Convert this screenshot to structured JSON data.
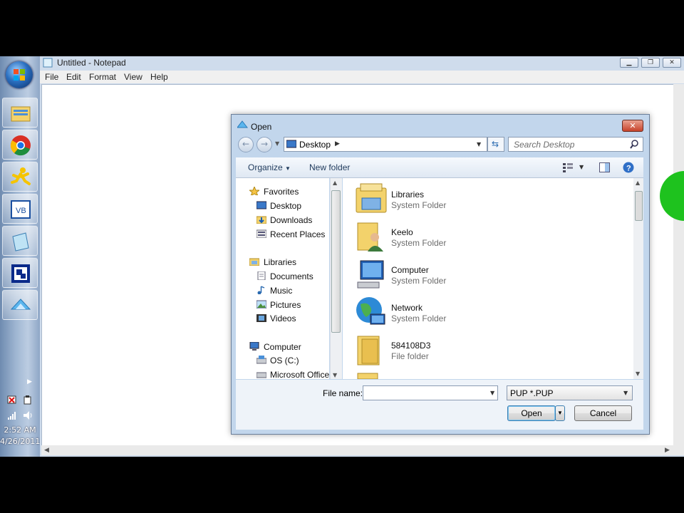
{
  "notepad": {
    "title": "Untitled - Notepad",
    "menu": [
      "File",
      "Edit",
      "Format",
      "View",
      "Help"
    ]
  },
  "taskbar": {
    "clock_time": "2:52 AM",
    "clock_date": "4/26/2011",
    "pinned": [
      "explorer-icon",
      "chrome-icon",
      "aim-icon",
      "vb-icon",
      "notepad-icon",
      "app-icon",
      "pup-icon"
    ]
  },
  "dialog": {
    "title": "Open",
    "address": "Desktop",
    "search_placeholder": "Search Desktop",
    "toolbar": {
      "organize": "Organize",
      "new_folder": "New folder"
    },
    "nav": {
      "favorites_header": "Favorites",
      "favorites": [
        "Desktop",
        "Downloads",
        "Recent Places"
      ],
      "libraries_header": "Libraries",
      "libraries": [
        "Documents",
        "Music",
        "Pictures",
        "Videos"
      ],
      "computer_header": "Computer",
      "computer": [
        "OS (C:)",
        "Microsoft Office"
      ]
    },
    "files": [
      {
        "name": "Libraries",
        "type": "System Folder",
        "icon": "libraries-icon"
      },
      {
        "name": "Keelo",
        "type": "System Folder",
        "icon": "user-folder-icon"
      },
      {
        "name": "Computer",
        "type": "System Folder",
        "icon": "computer-icon"
      },
      {
        "name": "Network",
        "type": "System Folder",
        "icon": "network-icon"
      },
      {
        "name": "584108D3",
        "type": "File folder",
        "icon": "folder-icon"
      }
    ],
    "file_name_label": "File name:",
    "file_name_value": "",
    "filter": "PUP *.PUP",
    "open_label": "Open",
    "cancel_label": "Cancel"
  }
}
